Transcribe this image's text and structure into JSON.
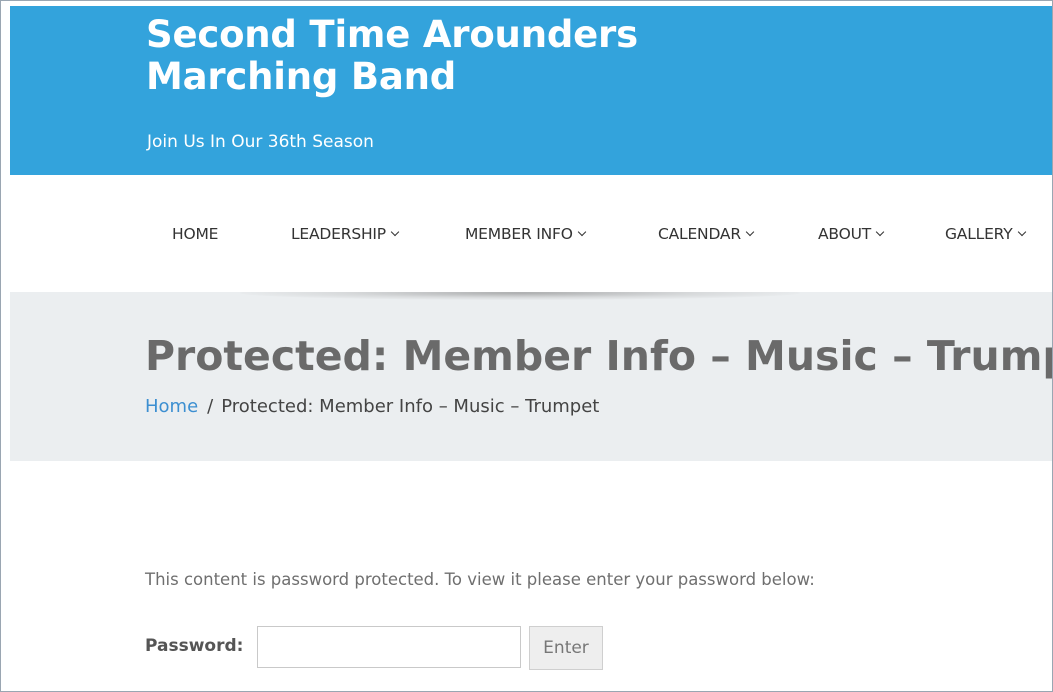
{
  "header": {
    "title_line1": "Second Time Arounders",
    "title_line2": "Marching Band",
    "tagline": "Join Us In Our 36th Season",
    "background_color": "#33a3dc"
  },
  "nav": {
    "items": [
      {
        "label": "HOME",
        "has_dropdown": false
      },
      {
        "label": "LEADERSHIP",
        "has_dropdown": true
      },
      {
        "label": "MEMBER INFO",
        "has_dropdown": true
      },
      {
        "label": "CALENDAR",
        "has_dropdown": true
      },
      {
        "label": "ABOUT",
        "has_dropdown": true
      },
      {
        "label": "GALLERY",
        "has_dropdown": true
      }
    ]
  },
  "page": {
    "title": "Protected: Member Info – Music – Trumpet",
    "breadcrumb": {
      "home": "Home",
      "separator": "/",
      "current": "Protected: Member Info – Music – Trumpet"
    }
  },
  "content": {
    "notice": "This content is password protected. To view it please enter your password below:",
    "password_label": "Password:",
    "password_value": "",
    "submit_label": "Enter"
  }
}
